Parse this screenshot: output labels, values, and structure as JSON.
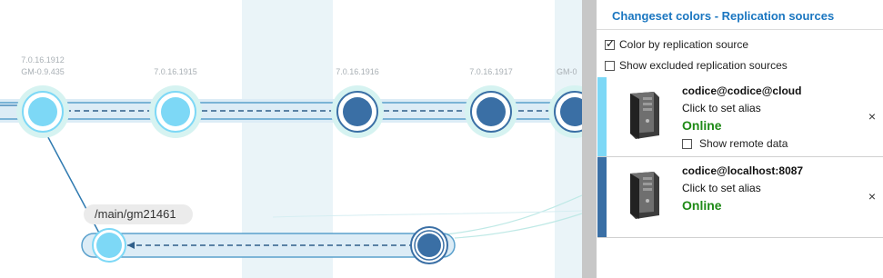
{
  "graph": {
    "changesets": [
      {
        "version": "7.0.16.1912",
        "label": "GM-0.9.435"
      },
      {
        "version": "7.0.16.1915",
        "label": ""
      },
      {
        "version": "7.0.16.1916",
        "label": ""
      },
      {
        "version": "7.0.16.1917",
        "label": "GM-0"
      }
    ],
    "branch_label": "/main/gm21461",
    "colors": {
      "cloud": "#7dd8f6",
      "localhost": "#3a6fa5",
      "band": "#e9f4f8",
      "halo": "#d6f3f1",
      "line": "#2f7ab0"
    }
  },
  "panel": {
    "title": "Changeset colors - Replication sources",
    "color_by_source": {
      "label": "Color by replication source",
      "checked": true
    },
    "show_excluded": {
      "label": "Show excluded replication sources",
      "checked": false
    },
    "sources": [
      {
        "name": "codice@codice@cloud",
        "alias": "Click to set alias",
        "status": "Online",
        "remote_label": "Show remote data",
        "remote_checked": false,
        "color": "#7dd8f6",
        "icon": "server-icon",
        "close": "×"
      },
      {
        "name": "codice@localhost:8087",
        "alias": "Click to set alias",
        "status": "Online",
        "color": "#3a6fa5",
        "icon": "server-icon",
        "close": "×"
      }
    ]
  }
}
